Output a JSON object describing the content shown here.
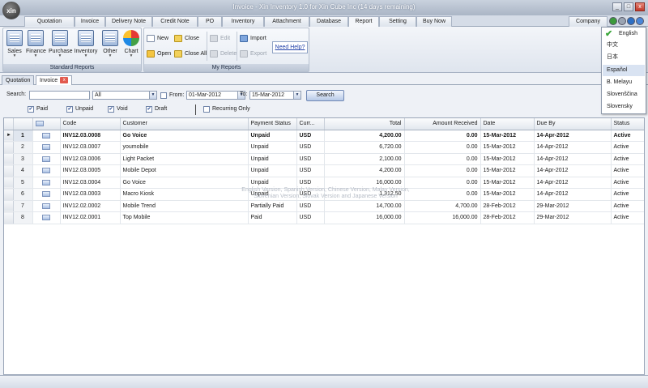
{
  "window": {
    "title": "Invoice - Xin Inventory 1.0 for Xin Cube Inc (14 days remaining)",
    "logo_text": "xin",
    "minimize": "_",
    "maximize": "□",
    "close": "x"
  },
  "menu": {
    "tabs": [
      "Quotation",
      "Invoice",
      "Delivery Note",
      "Credit Note",
      "PO",
      "Inventory",
      "Attachment",
      "Database",
      "Report",
      "Setting",
      "Buy Now",
      "Company"
    ],
    "active": "Report"
  },
  "ribbon": {
    "standard_reports": {
      "label": "Standard Reports",
      "buttons": [
        "Sales",
        "Finance",
        "Purchase",
        "Inventory",
        "Other",
        "Chart"
      ]
    },
    "my_reports": {
      "label": "My Reports",
      "new": "New",
      "open": "Open",
      "close": "Close",
      "close_all": "Close All",
      "edit": "Edit",
      "delete": "Delete",
      "import": "Import",
      "export": "Export",
      "help": "Need Help?"
    }
  },
  "doc_tabs": {
    "quotation": "Quotation",
    "invoice": "Invoice",
    "close_icon": "x"
  },
  "search": {
    "label": "Search:",
    "query": "",
    "scope": "All",
    "from_label": "From:",
    "from_date": "01-Mar-2012",
    "to_label": "To:",
    "to_date": "15-Mar-2012",
    "button": "Search",
    "filters": {
      "paid": "Paid",
      "unpaid": "Unpaid",
      "void": "Void",
      "draft": "Draft",
      "recurring": "Recurring Only"
    }
  },
  "grid": {
    "columns": [
      "Code",
      "Customer",
      "Payment Status",
      "Curr...",
      "Total",
      "Amount Received",
      "Date",
      "Due By",
      "Status"
    ],
    "rows": [
      {
        "no": "1",
        "code": "INV12.03.0008",
        "customer": "Go Voice",
        "pay": "Unpaid",
        "curr": "USD",
        "total": "4,200.00",
        "recv": "0.00",
        "date": "15-Mar-2012",
        "due": "14-Apr-2012",
        "status": "Active"
      },
      {
        "no": "2",
        "code": "INV12.03.0007",
        "customer": "youmobile",
        "pay": "Unpaid",
        "curr": "USD",
        "total": "6,720.00",
        "recv": "0.00",
        "date": "15-Mar-2012",
        "due": "14-Apr-2012",
        "status": "Active"
      },
      {
        "no": "3",
        "code": "INV12.03.0006",
        "customer": "Light Packet",
        "pay": "Unpaid",
        "curr": "USD",
        "total": "2,100.00",
        "recv": "0.00",
        "date": "15-Mar-2012",
        "due": "14-Apr-2012",
        "status": "Active"
      },
      {
        "no": "4",
        "code": "INV12.03.0005",
        "customer": "Mobile Depot",
        "pay": "Unpaid",
        "curr": "USD",
        "total": "4,200.00",
        "recv": "0.00",
        "date": "15-Mar-2012",
        "due": "14-Apr-2012",
        "status": "Active"
      },
      {
        "no": "5",
        "code": "INV12.03.0004",
        "customer": "Go Voice",
        "pay": "Unpaid",
        "curr": "USD",
        "total": "16,000.00",
        "recv": "0.00",
        "date": "15-Mar-2012",
        "due": "14-Apr-2012",
        "status": "Active"
      },
      {
        "no": "6",
        "code": "INV12.03.0003",
        "customer": "Macro Kiosk",
        "pay": "Unpaid",
        "curr": "USD",
        "total": "1,312.50",
        "recv": "0.00",
        "date": "15-Mar-2012",
        "due": "14-Apr-2012",
        "status": "Active"
      },
      {
        "no": "7",
        "code": "INV12.02.0002",
        "customer": "Mobile Trend",
        "pay": "Partially Paid",
        "curr": "USD",
        "total": "14,700.00",
        "recv": "4,700.00",
        "date": "28-Feb-2012",
        "due": "29-Mar-2012",
        "status": "Active"
      },
      {
        "no": "8",
        "code": "INV12.02.0001",
        "customer": "Top Mobile",
        "pay": "Paid",
        "curr": "USD",
        "total": "16,000.00",
        "recv": "16,000.00",
        "date": "28-Feb-2012",
        "due": "29-Mar-2012",
        "status": "Active"
      }
    ]
  },
  "watermark": "English Version, Spanish Version, Chinese Version, Malay Version, Slovenian Version, Slovak Version and Japanese Version",
  "languages": {
    "items": [
      "English",
      "中文",
      "日本",
      "Español",
      "B. Melayu",
      "Slovenščina",
      "Slovensky"
    ],
    "selected": "English",
    "hovered": "Español"
  },
  "colors": {
    "accent": "#aab5c5",
    "highlight": "#d9e3f2",
    "check": "#3aa63a"
  }
}
